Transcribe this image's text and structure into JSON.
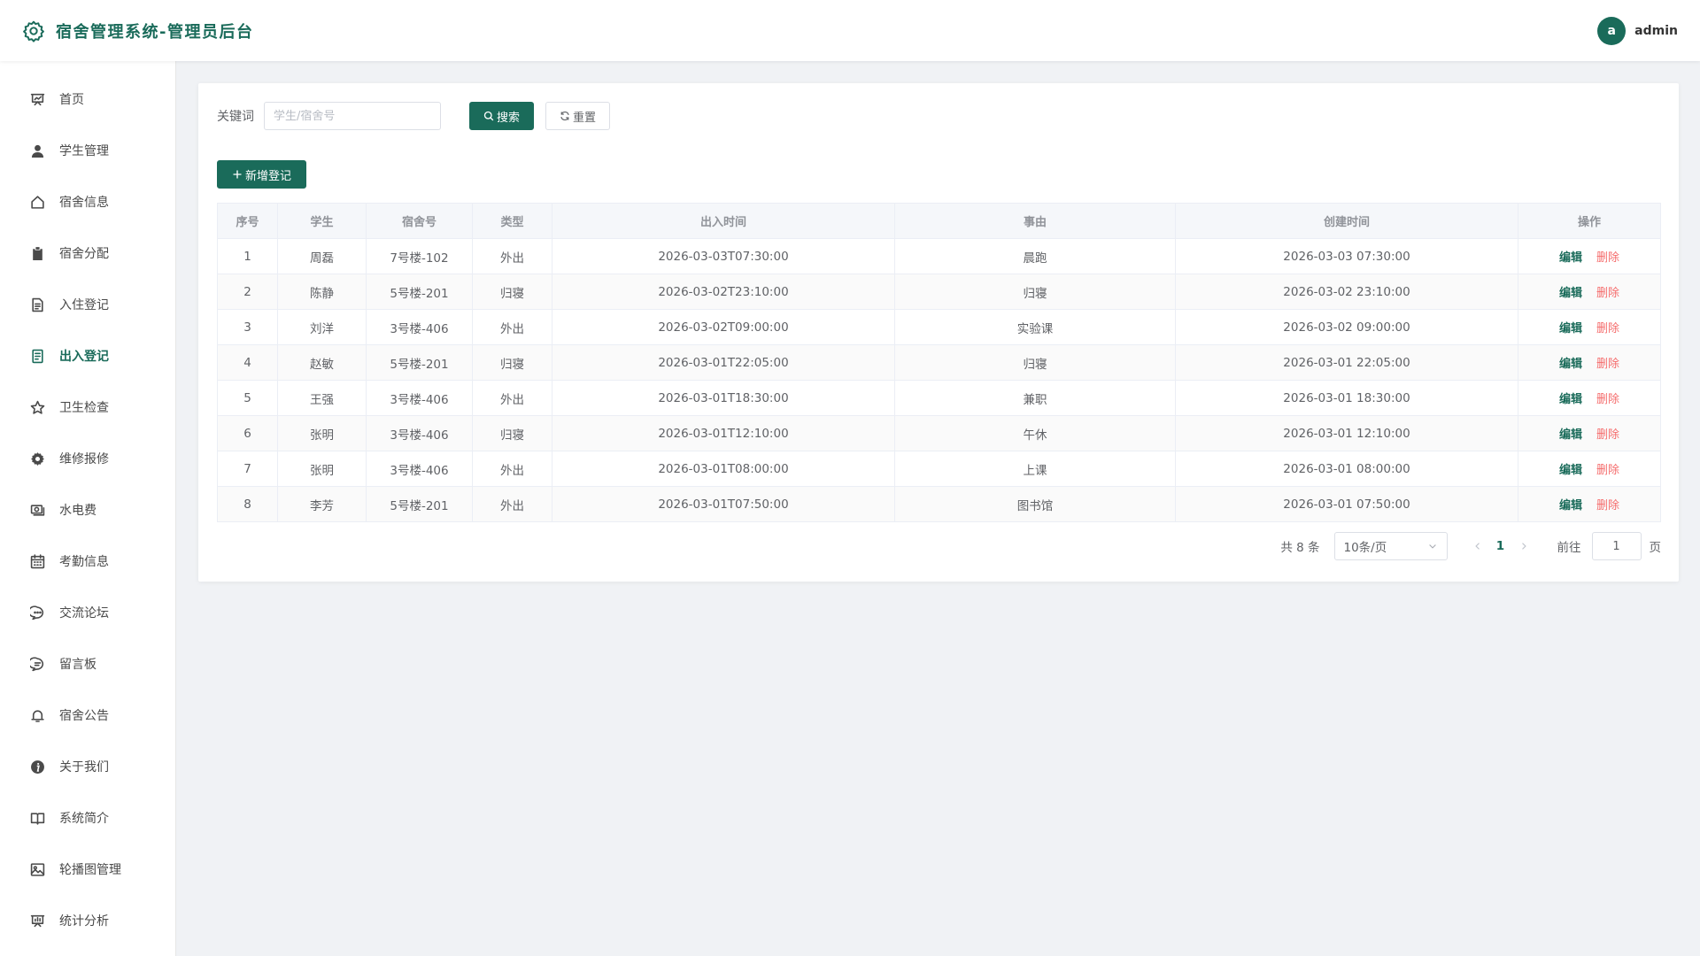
{
  "header": {
    "title": "宿舍管理系统-管理员后台",
    "avatar_letter": "a",
    "username": "admin"
  },
  "sidebar": {
    "items": [
      {
        "label": "首页",
        "icon": "presentation-icon"
      },
      {
        "label": "学生管理",
        "icon": "user-icon"
      },
      {
        "label": "宿舍信息",
        "icon": "house-icon"
      },
      {
        "label": "宿舍分配",
        "icon": "clipboard-icon"
      },
      {
        "label": "入住登记",
        "icon": "document-icon"
      },
      {
        "label": "出入登记",
        "icon": "tickets-icon",
        "active": true
      },
      {
        "label": "卫生检查",
        "icon": "star-icon"
      },
      {
        "label": "维修报修",
        "icon": "setting-icon"
      },
      {
        "label": "水电费",
        "icon": "money-icon"
      },
      {
        "label": "考勤信息",
        "icon": "calendar-icon"
      },
      {
        "label": "交流论坛",
        "icon": "chat-dots-icon"
      },
      {
        "label": "留言板",
        "icon": "chat-line-icon"
      },
      {
        "label": "宿舍公告",
        "icon": "bell-icon"
      },
      {
        "label": "关于我们",
        "icon": "info-icon"
      },
      {
        "label": "系统简介",
        "icon": "notebook-icon"
      },
      {
        "label": "轮播图管理",
        "icon": "picture-icon"
      },
      {
        "label": "统计分析",
        "icon": "data-board-icon"
      }
    ]
  },
  "search": {
    "label": "关键词",
    "placeholder": "学生/宿舍号",
    "search_label": "搜索",
    "reset_label": "重置"
  },
  "add_label": "新增登记",
  "table": {
    "headers": [
      "序号",
      "学生",
      "宿舍号",
      "类型",
      "出入时间",
      "事由",
      "创建时间",
      "操作"
    ],
    "edit_label": "编辑",
    "delete_label": "删除",
    "rows": [
      [
        "1",
        "周磊",
        "7号楼-102",
        "外出",
        "2026-03-03T07:30:00",
        "晨跑",
        "2026-03-03 07:30:00"
      ],
      [
        "2",
        "陈静",
        "5号楼-201",
        "归寝",
        "2026-03-02T23:10:00",
        "归寝",
        "2026-03-02 23:10:00"
      ],
      [
        "3",
        "刘洋",
        "3号楼-406",
        "外出",
        "2026-03-02T09:00:00",
        "实验课",
        "2026-03-02 09:00:00"
      ],
      [
        "4",
        "赵敏",
        "5号楼-201",
        "归寝",
        "2026-03-01T22:05:00",
        "归寝",
        "2026-03-01 22:05:00"
      ],
      [
        "5",
        "王强",
        "3号楼-406",
        "外出",
        "2026-03-01T18:30:00",
        "兼职",
        "2026-03-01 18:30:00"
      ],
      [
        "6",
        "张明",
        "3号楼-406",
        "归寝",
        "2026-03-01T12:10:00",
        "午休",
        "2026-03-01 12:10:00"
      ],
      [
        "7",
        "张明",
        "3号楼-406",
        "外出",
        "2026-03-01T08:00:00",
        "上课",
        "2026-03-01 08:00:00"
      ],
      [
        "8",
        "李芳",
        "5号楼-201",
        "外出",
        "2026-03-01T07:50:00",
        "图书馆",
        "2026-03-01 07:50:00"
      ]
    ]
  },
  "pagination": {
    "total_text": "共 8 条",
    "page_size": "10条/页",
    "current_page": "1",
    "goto_label": "前往",
    "goto_value": "1",
    "page_suffix": "页"
  },
  "colors": {
    "primary": "#1a6b5a",
    "danger": "#f56c6c"
  }
}
